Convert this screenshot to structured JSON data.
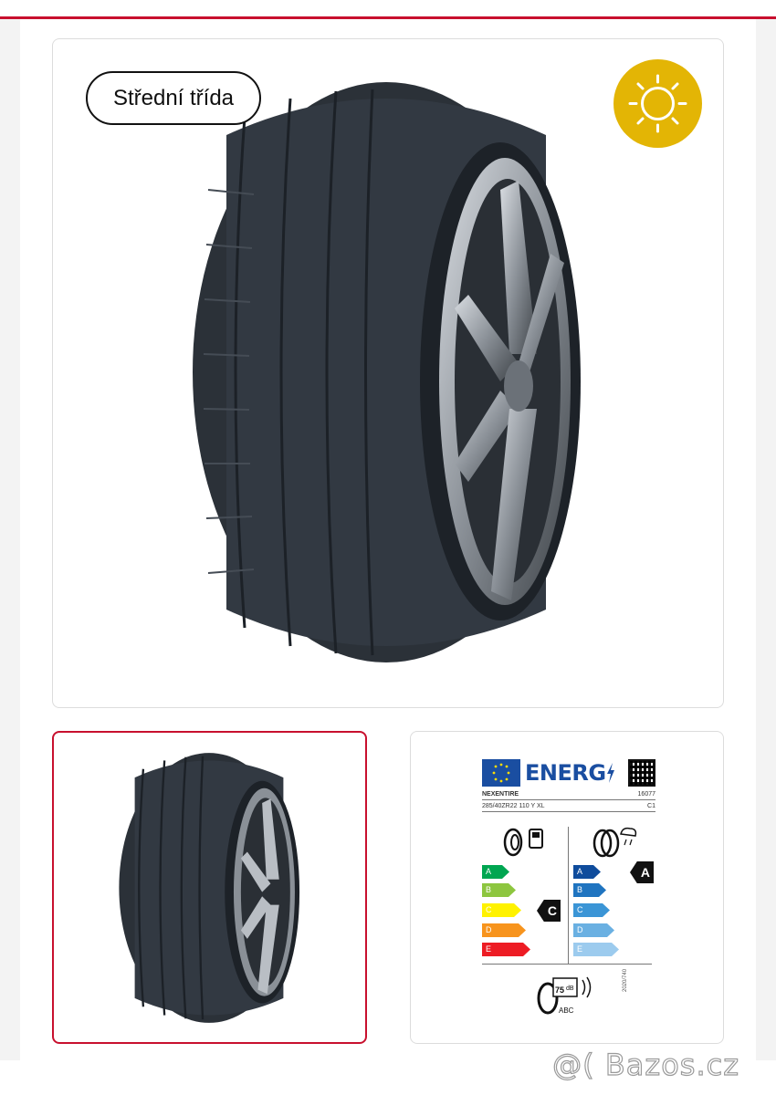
{
  "main_card": {
    "class_badge": "Střední třída",
    "season_icon": "sun-icon",
    "season_color": "#e3b505"
  },
  "energy_label": {
    "header": "ENERG",
    "brand": "NEXENTIRE",
    "code": "16077",
    "size": "285/40ZR22 110 Y XL",
    "tyre_class": "C1",
    "fuel_grades": [
      "A",
      "B",
      "C",
      "D",
      "E"
    ],
    "fuel_rating": "C",
    "wet_grades": [
      "A",
      "B",
      "C",
      "D",
      "E"
    ],
    "wet_rating": "A",
    "noise_db": "75",
    "noise_unit": "dB",
    "noise_class": "ABC",
    "side_code": "2020/740"
  },
  "watermark": "@( Bazos.cz",
  "colors": {
    "accent": "#c8102e",
    "eu_blue": "#1a4ea1",
    "fuel_A": "#00a651",
    "fuel_B": "#8dc63f",
    "fuel_C": "#fff200",
    "fuel_D": "#f7941d",
    "fuel_E": "#ed1c24",
    "wet_A": "#0f4c9c",
    "wet_B": "#1f74c0",
    "wet_C": "#3b95d6",
    "wet_D": "#6ab0e2",
    "wet_E": "#9ccbee"
  }
}
